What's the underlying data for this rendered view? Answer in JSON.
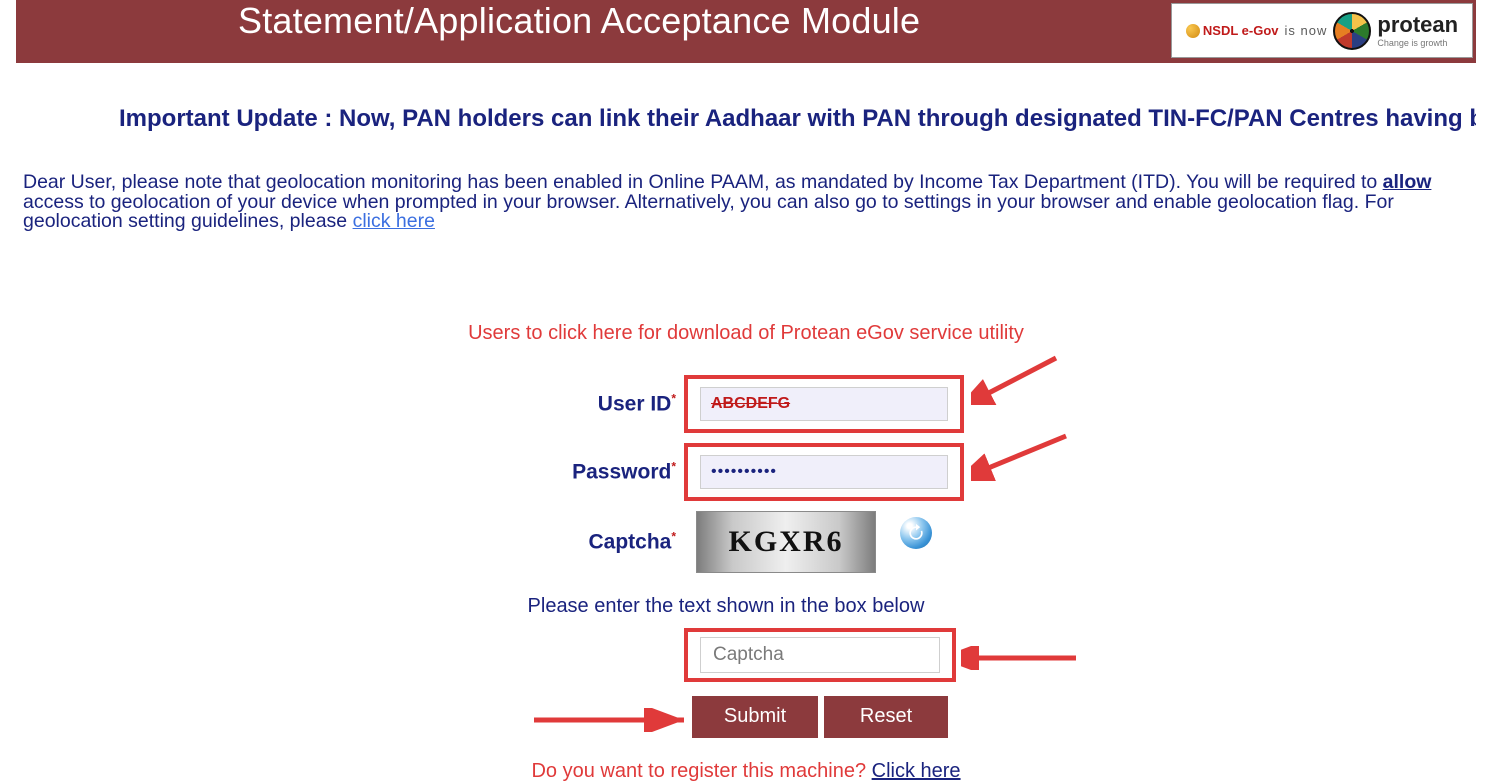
{
  "header": {
    "title": "Statement/Application Acceptance Module",
    "brand_prefix": "NSDL e-Gov",
    "brand_is_now": "is now",
    "brand_name": "protean",
    "brand_tagline": "Change is growth"
  },
  "important_update": "Important Update : Now, PAN holders can link their Aadhaar with PAN through designated TIN-FC/PAN Centres having biometric",
  "geo_note": {
    "part1": "Dear User, please note that geolocation monitoring has been enabled in Online PAAM, as mandated by Income Tax Department (ITD). You will be required to ",
    "allow": "allow",
    "part2": " access to geolocation of your device when prompted in your browser. Alternatively, you can also go to settings in your browser and enable geolocation flag. For geolocation setting guidelines, please ",
    "link": "click here"
  },
  "download_line": "Users to click here for download of Protean eGov service utility",
  "labels": {
    "user_id": "User ID",
    "password": "Password",
    "captcha": "Captcha"
  },
  "fields": {
    "user_id_value": "ABCDEFG",
    "password_value": "••••••••••",
    "captcha_image_text": "KGXR6",
    "captcha_placeholder": "Captcha"
  },
  "hint": "Please enter the text shown in the box below",
  "buttons": {
    "submit": "Submit",
    "reset": "Reset"
  },
  "register": {
    "question": "Do you want to register this machine? ",
    "link": "Click here"
  }
}
